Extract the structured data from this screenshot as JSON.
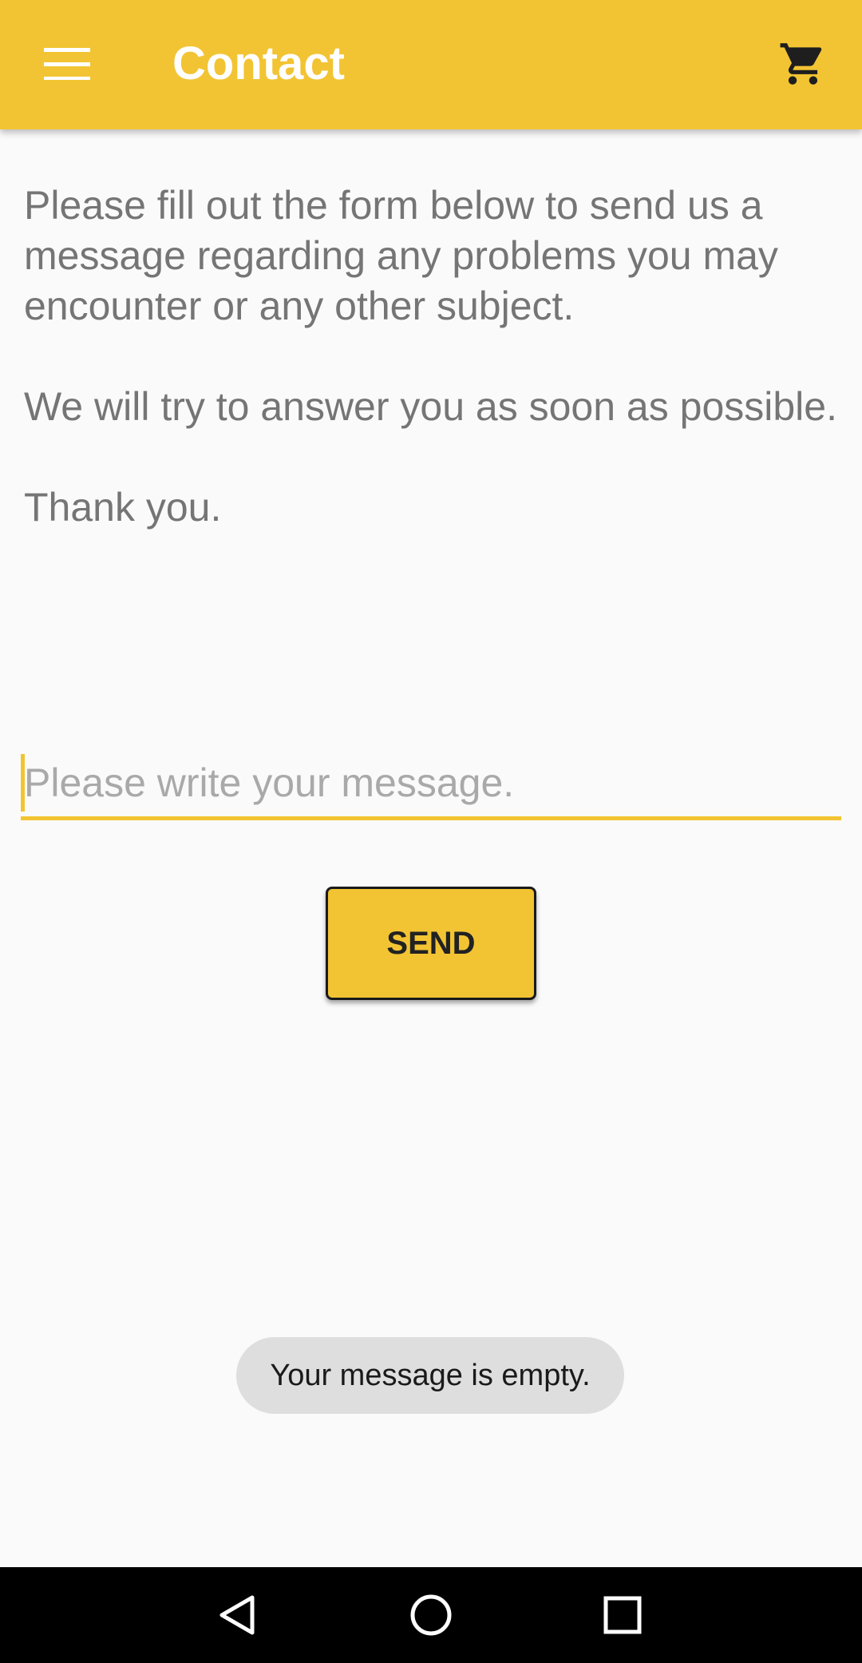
{
  "app_bar": {
    "title": "Contact",
    "background_color": "#f2c433",
    "menu_icon": "hamburger-menu-icon",
    "cart_icon": "shopping-cart-icon"
  },
  "intro": {
    "paragraph_1": "Please fill out the form below to send us a message regarding any problems you may encounter or any other subject.",
    "paragraph_2": "We will try to answer you as soon as possible.",
    "paragraph_3": "Thank you."
  },
  "message_field": {
    "value": "",
    "placeholder": "Please write your message."
  },
  "send_button": {
    "label": "SEND"
  },
  "toast": {
    "text": "Your message is empty."
  },
  "nav_bar": {
    "back_icon": "back-triangle-icon",
    "home_icon": "home-circle-icon",
    "recents_icon": "recents-square-icon"
  }
}
